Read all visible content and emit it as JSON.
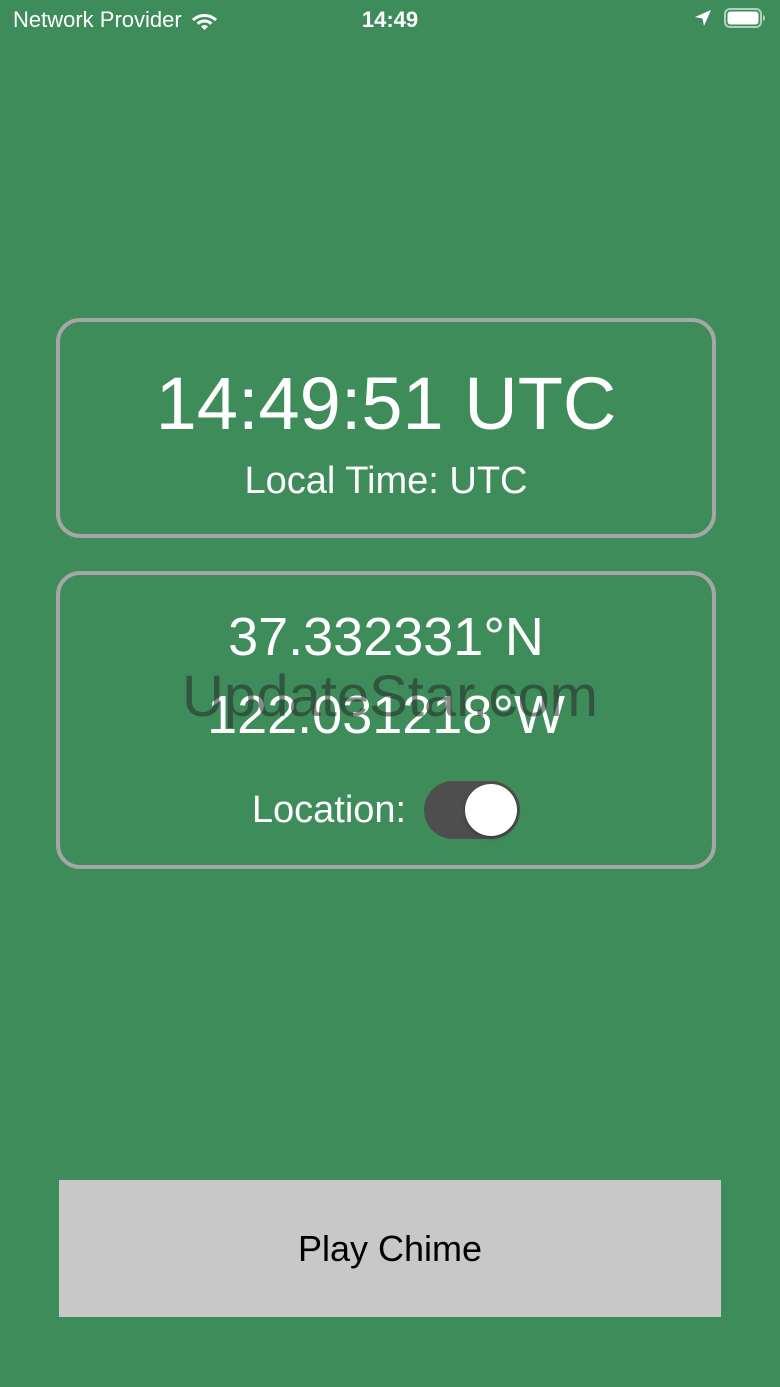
{
  "status_bar": {
    "carrier": "Network Provider",
    "time": "14:49",
    "icons": [
      "wifi-icon",
      "location-arrow-icon",
      "battery-icon"
    ]
  },
  "time_card": {
    "utc_time": "14:49:51 UTC",
    "local_time": "Local Time: UTC"
  },
  "location_card": {
    "latitude": "37.332331°N",
    "longitude": "122.031218°W",
    "location_label": "Location:",
    "location_enabled": true
  },
  "watermark": "UpdateStar.com",
  "play_button": {
    "label": "Play Chime"
  },
  "colors": {
    "background": "#3f8c5b",
    "card_border": "#a6a6a6",
    "button_background": "#c8c8c8",
    "toggle_track": "#4e4e4e"
  }
}
